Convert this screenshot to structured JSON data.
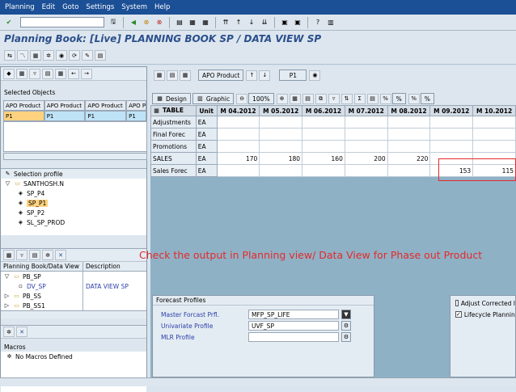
{
  "menu": [
    "Planning",
    "Edit",
    "Goto",
    "Settings",
    "System",
    "Help"
  ],
  "title": "Planning Book: [Live] PLANNING BOOK SP / DATA VIEW SP",
  "selected_objects": {
    "label": "Selected Objects",
    "headers": [
      "APO Product",
      "APO Product",
      "APO Product",
      "APO P"
    ],
    "values": [
      "P1",
      "P1",
      "P1",
      "P1"
    ]
  },
  "selection_profile": {
    "label": "Selection profile",
    "root": "SANTHOSH.N",
    "items": [
      "SP_P4",
      "SP_P1",
      "SP_P2",
      "SL_SP_PROD"
    ]
  },
  "planning_book_table": {
    "headers": [
      "Planning Book/Data View",
      "Description"
    ],
    "rows": [
      {
        "name": "PB_SP",
        "desc": ""
      },
      {
        "name": "DV_SP",
        "desc": "DATA VIEW SP"
      },
      {
        "name": "PB_SS",
        "desc": ""
      },
      {
        "name": "PB_SS1",
        "desc": ""
      }
    ]
  },
  "macros": {
    "label": "Macros",
    "item": "No Macros Defined"
  },
  "right_top": {
    "product_button": "APO Product",
    "value": "P1"
  },
  "grid_toolbar": {
    "design": "Design",
    "graphic": "Graphic",
    "zoom": "100%",
    "pct1": "%",
    "pct2": "%"
  },
  "grid": {
    "headers": [
      "TABLE",
      "Unit",
      "M 04.2012",
      "M 05.2012",
      "M 06.2012",
      "M 07.2012",
      "M 08.2012",
      "M 09.2012",
      "M 10.2012"
    ],
    "rows": [
      {
        "label": "Adjustments",
        "unit": "EA",
        "values": [
          "",
          "",
          "",
          "",
          "",
          "",
          ""
        ]
      },
      {
        "label": "Final Forec",
        "unit": "EA",
        "values": [
          "",
          "",
          "",
          "",
          "",
          "",
          ""
        ]
      },
      {
        "label": "Promotions",
        "unit": "EA",
        "values": [
          "",
          "",
          "",
          "",
          "",
          "",
          ""
        ]
      },
      {
        "label": "SALES",
        "unit": "EA",
        "values": [
          "170",
          "180",
          "160",
          "200",
          "220",
          "",
          ""
        ]
      },
      {
        "label": "Sales Forec",
        "unit": "EA",
        "values": [
          "",
          "",
          "",
          "",
          "",
          "153",
          "115"
        ]
      }
    ]
  },
  "annotation": "Check the output in Planning view/ Data View for Phase out Product",
  "forecast_profiles": {
    "label": "Forecast Profiles",
    "rows": [
      {
        "key": "Master Forcast Prfl.",
        "value": "MFP_SP_LIFE"
      },
      {
        "key": "Univariate Profile",
        "value": "UVF_SP"
      },
      {
        "key": "MLR Profile",
        "value": ""
      }
    ]
  },
  "checkboxes": [
    {
      "label": "Adjust Corrected I",
      "checked": false
    },
    {
      "label": "Lifecycle Planning",
      "checked": true
    }
  ],
  "colors": {
    "menubar": "#1b4f96",
    "title": "#2b4f8c",
    "annotation": "#e32a2a"
  }
}
